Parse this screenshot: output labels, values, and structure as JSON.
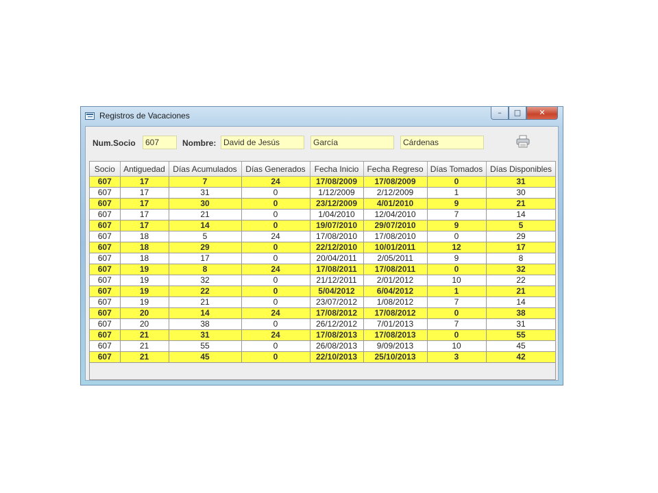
{
  "window": {
    "title": "Registros de Vacaciones",
    "min_glyph": "–",
    "max_glyph": "□",
    "close_glyph": "✕"
  },
  "form": {
    "num_socio_label": "Num.Socio",
    "num_socio_value": "607",
    "nombre_label": "Nombre:",
    "nombre_value": "David de Jesús",
    "apellido1_value": "García",
    "apellido2_value": "Cárdenas",
    "print_icon": "printer-icon"
  },
  "table": {
    "columns": [
      "Socio",
      "Antiguedad",
      "Días Acumulados",
      "Días Generados",
      "Fecha Inicio",
      "Fecha Regreso",
      "Días Tomados",
      "Días Disponibles"
    ],
    "rows": [
      [
        "607",
        "17",
        "7",
        "24",
        "17/08/2009",
        "17/08/2009",
        "0",
        "31"
      ],
      [
        "607",
        "17",
        "31",
        "0",
        "1/12/2009",
        "2/12/2009",
        "1",
        "30"
      ],
      [
        "607",
        "17",
        "30",
        "0",
        "23/12/2009",
        "4/01/2010",
        "9",
        "21"
      ],
      [
        "607",
        "17",
        "21",
        "0",
        "1/04/2010",
        "12/04/2010",
        "7",
        "14"
      ],
      [
        "607",
        "17",
        "14",
        "0",
        "19/07/2010",
        "29/07/2010",
        "9",
        "5"
      ],
      [
        "607",
        "18",
        "5",
        "24",
        "17/08/2010",
        "17/08/2010",
        "0",
        "29"
      ],
      [
        "607",
        "18",
        "29",
        "0",
        "22/12/2010",
        "10/01/2011",
        "12",
        "17"
      ],
      [
        "607",
        "18",
        "17",
        "0",
        "20/04/2011",
        "2/05/2011",
        "9",
        "8"
      ],
      [
        "607",
        "19",
        "8",
        "24",
        "17/08/2011",
        "17/08/2011",
        "0",
        "32"
      ],
      [
        "607",
        "19",
        "32",
        "0",
        "21/12/2011",
        "2/01/2012",
        "10",
        "22"
      ],
      [
        "607",
        "19",
        "22",
        "0",
        "5/04/2012",
        "6/04/2012",
        "1",
        "21"
      ],
      [
        "607",
        "19",
        "21",
        "0",
        "23/07/2012",
        "1/08/2012",
        "7",
        "14"
      ],
      [
        "607",
        "20",
        "14",
        "24",
        "17/08/2012",
        "17/08/2012",
        "0",
        "38"
      ],
      [
        "607",
        "20",
        "38",
        "0",
        "26/12/2012",
        "7/01/2013",
        "7",
        "31"
      ],
      [
        "607",
        "21",
        "31",
        "24",
        "17/08/2013",
        "17/08/2013",
        "0",
        "55"
      ],
      [
        "607",
        "21",
        "55",
        "0",
        "26/08/2013",
        "9/09/2013",
        "10",
        "45"
      ],
      [
        "607",
        "21",
        "45",
        "0",
        "22/10/2013",
        "25/10/2013",
        "3",
        "42"
      ]
    ]
  },
  "colors": {
    "highlight_row": "#ffff4c",
    "field_background": "#ffffc4"
  }
}
